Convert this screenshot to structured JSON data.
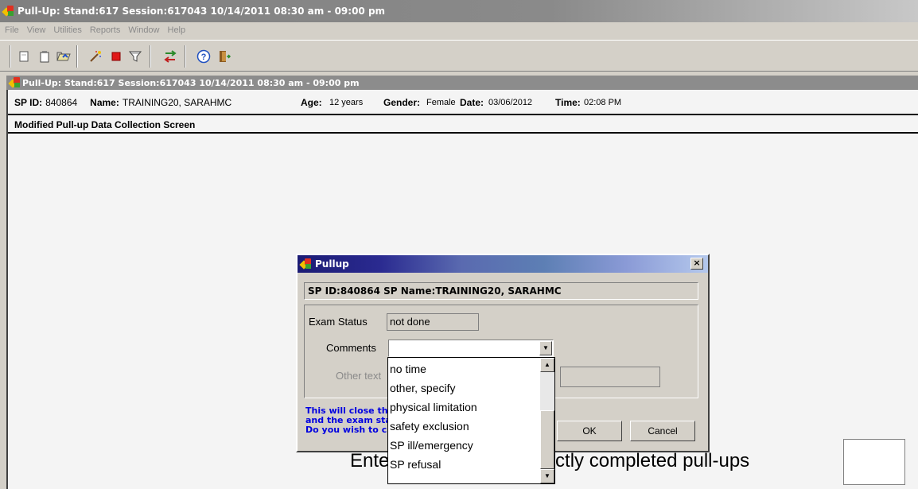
{
  "app": {
    "title": "Pull-Up: Stand:617 Session:617043 10/14/2011 08:30 am - 09:00 pm",
    "menu": [
      "File",
      "View",
      "Utilities",
      "Reports",
      "Window",
      "Help"
    ]
  },
  "toolbar": {
    "icons": [
      "new-doc-icon",
      "clipboard-icon",
      "folder-icon",
      "magic-wand-icon",
      "stop-icon",
      "filter-icon",
      "transfer-icon",
      "help-icon",
      "exit-icon"
    ]
  },
  "inner_window": {
    "title": "Pull-Up: Stand:617 Session:617043 10/14/2011 08:30 am - 09:00 pm"
  },
  "participant": {
    "sp_id_label": "SP ID:",
    "sp_id": "840864",
    "name_label": "Name:",
    "name": "TRAINING20, SARAHMC",
    "age_label": "Age:",
    "age": "12 years",
    "gender_label": "Gender:",
    "gender": "Female",
    "date_label": "Date:",
    "date": "03/06/2012",
    "time_label": "Time:",
    "time": "02:08 PM"
  },
  "screen": {
    "title": "Modified Pull-up Data Collection Screen",
    "entry_prompt": "Enter",
    "entry_prompt_tail": "correctly completed pull-ups"
  },
  "dialog": {
    "title": "Pullup",
    "close_label": "×",
    "sp_line": "SP ID:840864 SP Name:TRAINING20, SARAHMC",
    "exam_status_label": "Exam Status",
    "exam_status_value": "not done",
    "comments_label": "Comments",
    "comments_value": "",
    "other_text_label": "Other text",
    "warning_line1": "This will close th",
    "warning_line2": "and the exam sta",
    "warning_line3": "Do you wish to c",
    "ok_label": "OK",
    "cancel_label": "Cancel"
  },
  "dropdown": {
    "options": [
      "no time",
      "other, specify",
      "physical limitation",
      "safety exclusion",
      "SP ill/emergency",
      "SP refusal"
    ]
  },
  "colors": {
    "dialog_title_start": "#1b1b74",
    "dialog_title_end": "#b4c8ec",
    "warning_text": "#0000e0"
  }
}
